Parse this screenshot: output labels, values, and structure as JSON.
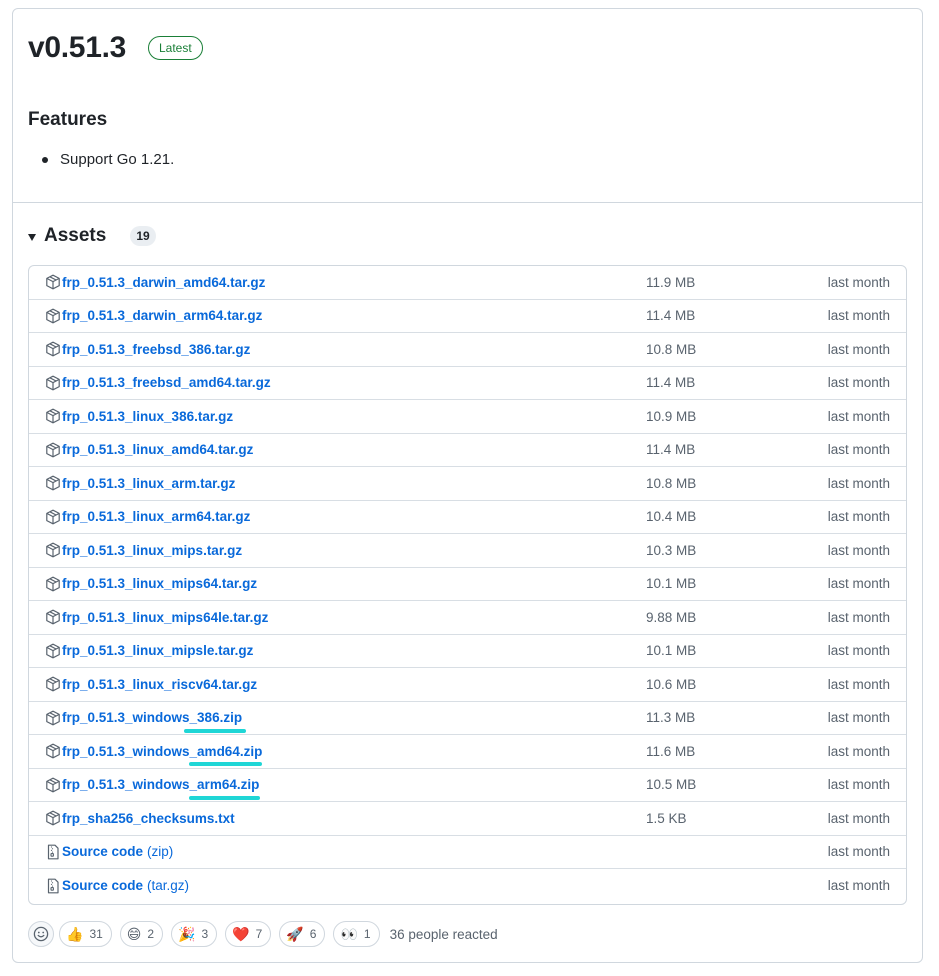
{
  "release": {
    "title": "v0.51.3",
    "badge": "Latest",
    "features_heading": "Features",
    "features": [
      "Support Go 1.21."
    ]
  },
  "assets": {
    "title": "Assets",
    "count": "19",
    "items": [
      {
        "name": "frp_0.51.3_darwin_amd64.tar.gz",
        "size": "11.9 MB",
        "date": "last month",
        "icon": "package-icon"
      },
      {
        "name": "frp_0.51.3_darwin_arm64.tar.gz",
        "size": "11.4 MB",
        "date": "last month",
        "icon": "package-icon"
      },
      {
        "name": "frp_0.51.3_freebsd_386.tar.gz",
        "size": "10.8 MB",
        "date": "last month",
        "icon": "package-icon"
      },
      {
        "name": "frp_0.51.3_freebsd_amd64.tar.gz",
        "size": "11.4 MB",
        "date": "last month",
        "icon": "package-icon"
      },
      {
        "name": "frp_0.51.3_linux_386.tar.gz",
        "size": "10.9 MB",
        "date": "last month",
        "icon": "package-icon"
      },
      {
        "name": "frp_0.51.3_linux_amd64.tar.gz",
        "size": "11.4 MB",
        "date": "last month",
        "icon": "package-icon"
      },
      {
        "name": "frp_0.51.3_linux_arm.tar.gz",
        "size": "10.8 MB",
        "date": "last month",
        "icon": "package-icon"
      },
      {
        "name": "frp_0.51.3_linux_arm64.tar.gz",
        "size": "10.4 MB",
        "date": "last month",
        "icon": "package-icon"
      },
      {
        "name": "frp_0.51.3_linux_mips.tar.gz",
        "size": "10.3 MB",
        "date": "last month",
        "icon": "package-icon"
      },
      {
        "name": "frp_0.51.3_linux_mips64.tar.gz",
        "size": "10.1 MB",
        "date": "last month",
        "icon": "package-icon"
      },
      {
        "name": "frp_0.51.3_linux_mips64le.tar.gz",
        "size": "9.88 MB",
        "date": "last month",
        "icon": "package-icon"
      },
      {
        "name": "frp_0.51.3_linux_mipsle.tar.gz",
        "size": "10.1 MB",
        "date": "last month",
        "icon": "package-icon"
      },
      {
        "name": "frp_0.51.3_linux_riscv64.tar.gz",
        "size": "10.6 MB",
        "date": "last month",
        "icon": "package-icon"
      },
      {
        "name": "frp_0.51.3_windows_386.zip",
        "size": "11.3 MB",
        "date": "last month",
        "icon": "package-icon"
      },
      {
        "name": "frp_0.51.3_windows_amd64.zip",
        "size": "11.6 MB",
        "date": "last month",
        "icon": "package-icon"
      },
      {
        "name": "frp_0.51.3_windows_arm64.zip",
        "size": "10.5 MB",
        "date": "last month",
        "icon": "package-icon"
      },
      {
        "name": "frp_sha256_checksums.txt",
        "size": "1.5 KB",
        "date": "last month",
        "icon": "package-icon"
      },
      {
        "name": "Source code",
        "suffix": "(zip)",
        "size": "",
        "date": "last month",
        "icon": "file-zip-icon"
      },
      {
        "name": "Source code",
        "suffix": "(tar.gz)",
        "size": "",
        "date": "last month",
        "icon": "file-zip-icon"
      }
    ],
    "highlight_color": "#1fd6d6"
  },
  "reactions": {
    "items": [
      {
        "emoji": "👍",
        "count": "31",
        "icon": "thumbs-up-icon"
      },
      {
        "emoji": "😄",
        "count": "2",
        "icon": "laugh-icon"
      },
      {
        "emoji": "🎉",
        "count": "3",
        "icon": "hooray-icon"
      },
      {
        "emoji": "❤️",
        "count": "7",
        "icon": "heart-icon"
      },
      {
        "emoji": "🚀",
        "count": "6",
        "icon": "rocket-icon"
      },
      {
        "emoji": "👀",
        "count": "1",
        "icon": "eyes-icon"
      }
    ],
    "summary": "36 people reacted"
  },
  "colors": {
    "link": "#0969da",
    "muted": "#59636e",
    "latest": "#1a7f37",
    "border": "#d0d7de"
  }
}
